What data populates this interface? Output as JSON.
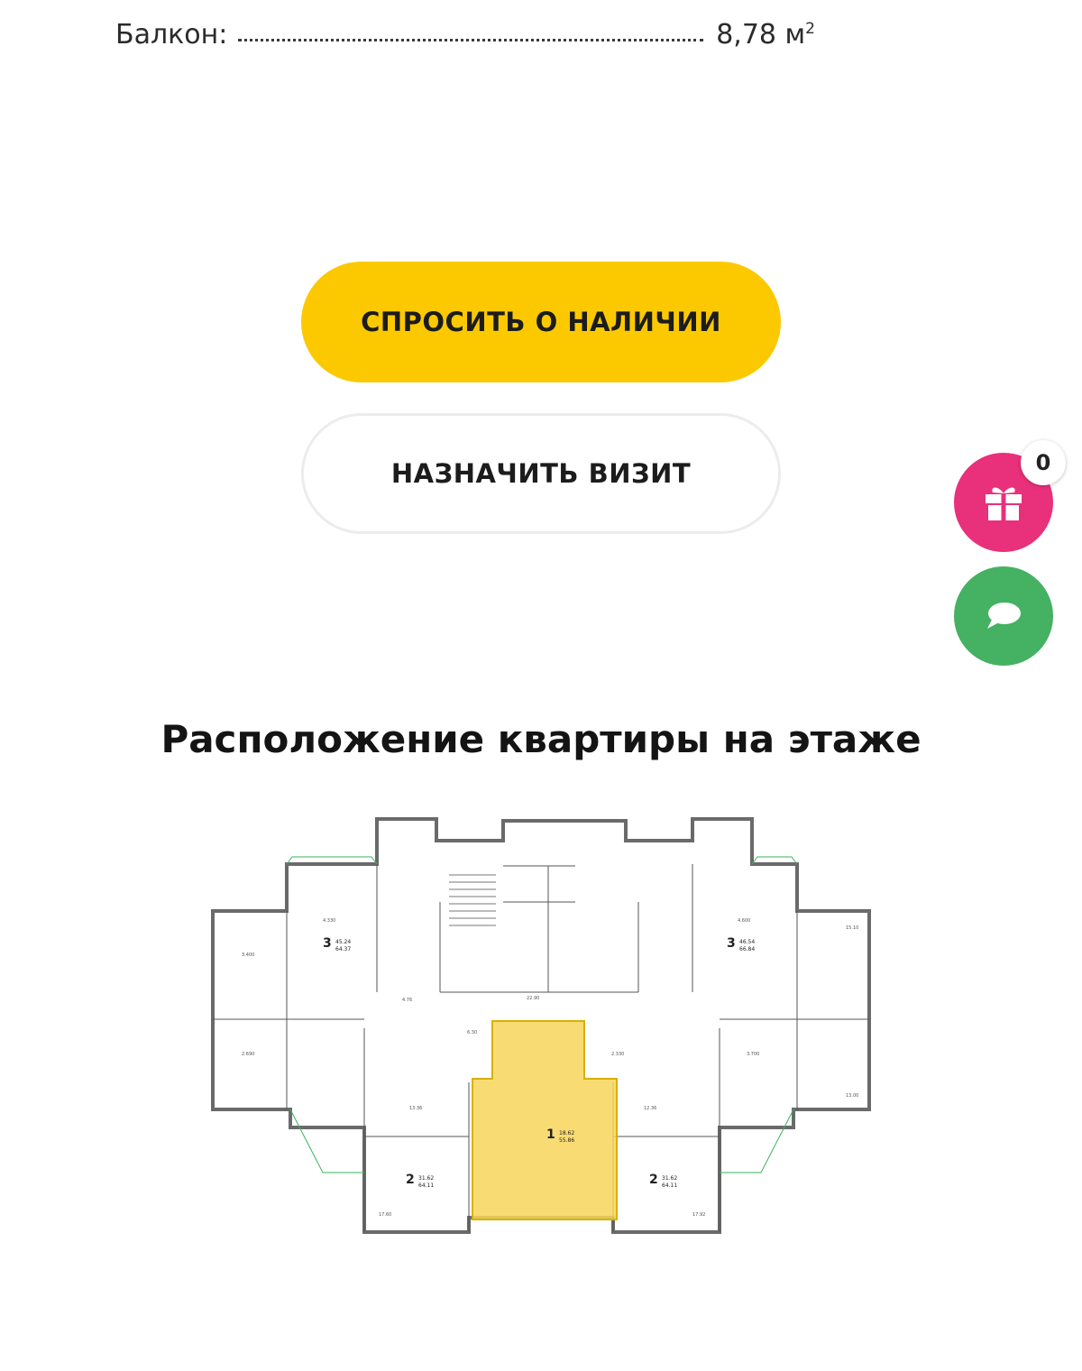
{
  "spec": {
    "label": "Балкон:",
    "value": "8,78 м",
    "unit_sup": "2"
  },
  "buttons": {
    "ask": "СПРОСИТЬ О НАЛИЧИИ",
    "visit": "НАЗНАЧИТЬ ВИЗИТ"
  },
  "floating": {
    "gift_count": "0",
    "gift_icon": "gift-icon",
    "chat_icon": "chat-icon"
  },
  "section": {
    "title": "Расположение квартиры на этаже"
  },
  "floor_plan": {
    "highlight_color": "#f7d65a",
    "apartments": [
      {
        "rooms": "3",
        "area": "45.24",
        "total": "64.37"
      },
      {
        "rooms": "3",
        "area": "46.54",
        "total": "66.84"
      },
      {
        "rooms": "1",
        "area": "18.62",
        "total": "55.86"
      },
      {
        "rooms": "2",
        "area": "31.62",
        "total": "64.11"
      },
      {
        "rooms": "2",
        "area": "31.62",
        "total": "64.11"
      }
    ],
    "dimensions": [
      "4.330",
      "3.400",
      "2.690",
      "22.90",
      "13.36",
      "12.36",
      "17.60",
      "17.92",
      "6.30",
      "4.600",
      "3.700",
      "2.330",
      "4.76",
      "15.10",
      "13.00"
    ]
  },
  "colors": {
    "accent_yellow": "#fcc900",
    "gift_pink": "#e9307a",
    "chat_green": "#45b163"
  }
}
